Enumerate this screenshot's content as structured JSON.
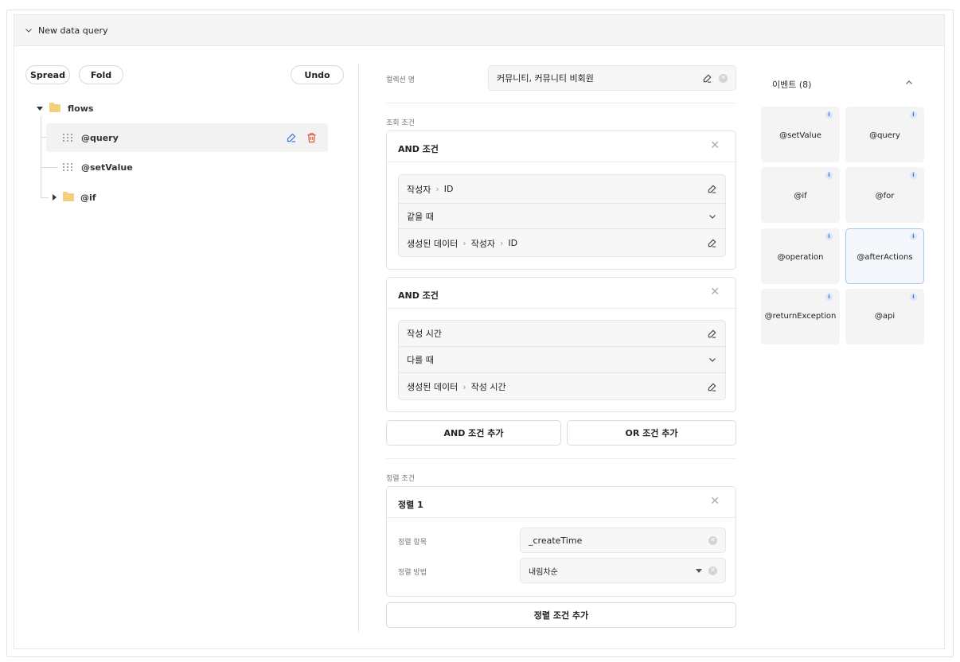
{
  "panel": {
    "title": "New data query"
  },
  "toolbar": {
    "spread_label": "Spread",
    "fold_label": "Fold",
    "undo_label": "Undo"
  },
  "tree": {
    "root_label": "flows",
    "items": [
      {
        "label": "@query",
        "type": "node"
      },
      {
        "label": "@setValue",
        "type": "node"
      },
      {
        "label": "@if",
        "type": "folder"
      }
    ]
  },
  "collection": {
    "label": "컬렉션 명",
    "value": "커뮤니티, 커뮤니티 비회원"
  },
  "query_conditions": {
    "section_label": "조회 조건",
    "groups": [
      {
        "title": "AND 조건",
        "field": [
          "작성자",
          "ID"
        ],
        "operator": "같을 때",
        "target": [
          "생성된 데이터",
          "작성자",
          "ID"
        ]
      },
      {
        "title": "AND 조건",
        "field": [
          "작성 시간"
        ],
        "operator": "다를 때",
        "target": [
          "생성된 데이터",
          "작성 시간"
        ]
      }
    ],
    "add_and_label": "AND 조건 추가",
    "add_or_label": "OR 조건 추가"
  },
  "sort_conditions": {
    "section_label": "정렬 조건",
    "card_title": "정렬 1",
    "item_label": "정렬 항목",
    "item_value": "_createTime",
    "method_label": "정렬 방법",
    "method_value": "내림차순",
    "add_label": "정렬 조건 추가"
  },
  "events": {
    "title": "이벤트 (8)",
    "items": [
      "@setValue",
      "@query",
      "@if",
      "@for",
      "@operation",
      "@afterActions",
      "@returnException",
      "@api"
    ],
    "active": "@afterActions",
    "info_glyph": "i"
  },
  "colors": {
    "accent_blue": "#3a6fd8",
    "danger_red": "#e5533d",
    "folder_yellow": "#f5d07a"
  }
}
